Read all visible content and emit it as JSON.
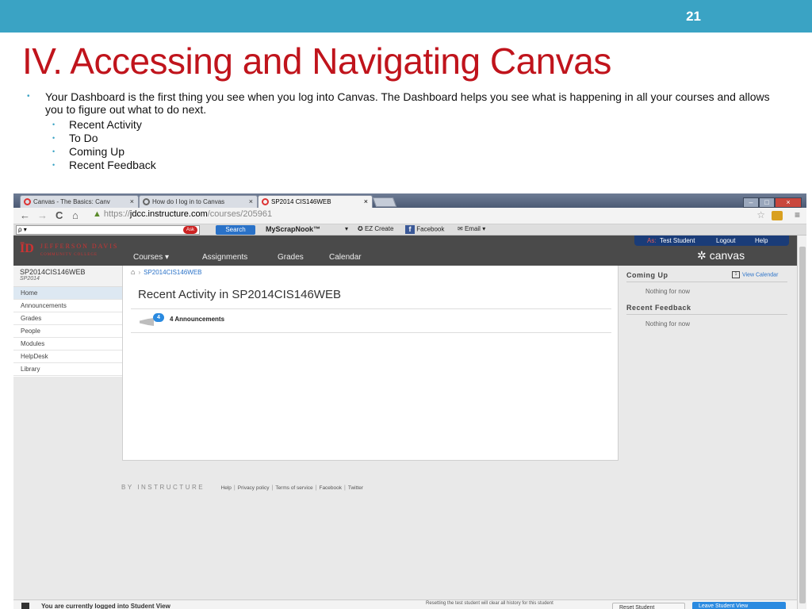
{
  "slide": {
    "number": "21",
    "title": "IV. Accessing and Navigating Canvas",
    "bullet": "Your Dashboard is the first thing you see when you log into Canvas. The Dashboard helps you see what is happening in all your courses and allows you to figure out what to do next.",
    "subbullets": [
      "Recent Activity",
      "To Do",
      "Coming Up",
      "Recent Feedback"
    ]
  },
  "browser": {
    "tabs": [
      "Canvas - The Basics: Canv",
      "How do I log in to Canvas",
      "SP2014 CIS146WEB"
    ],
    "tab_close": "×",
    "window_buttons": [
      "–",
      "□",
      "×"
    ],
    "back": "←",
    "forward": "→",
    "reload": "C",
    "home": "⌂",
    "url_scheme": "https://",
    "url_domain": "jdcc.instructure.com",
    "url_path": "/courses/205961",
    "star": "☆",
    "menu": "≡"
  },
  "toolbar": {
    "search_placeholder": "ρ ▾",
    "search_badge": "Ask",
    "search_button": "Search",
    "myscrapnook": "MyScrapNook™",
    "dropdown": "▾",
    "ez_create": "EZ Create",
    "facebook": "Facebook",
    "email": "Email",
    "email_dropdown": "▾"
  },
  "canvas_header": {
    "logo_mark": "ĪD",
    "logo_line1": "JEFFERSON DAVIS",
    "logo_line2": "COMMUNITY COLLEGE",
    "nav": [
      "Courses ▾",
      "Assignments",
      "Grades",
      "Calendar"
    ],
    "user_prefix": "As:",
    "user": "Test Student",
    "logout": "Logout",
    "help": "Help",
    "brand": "canvas",
    "brand_icon": "✲"
  },
  "sidebar": {
    "course": "SP2014CIS146WEB",
    "term": "SP2014",
    "items": [
      "Home",
      "Announcements",
      "Grades",
      "People",
      "Modules",
      "HelpDesk",
      "Library"
    ]
  },
  "main": {
    "breadcrumb_home": "⌂",
    "breadcrumb_sep": "›",
    "breadcrumb": "SP2014CIS146WEB",
    "title": "Recent Activity in SP2014CIS146WEB",
    "announcement_count": "4",
    "announcement_label": "4 Announcements"
  },
  "right": {
    "coming_up": "Coming Up",
    "view_calendar": "View Calendar",
    "calendar_icon_text": "1",
    "nothing1": "Nothing for now",
    "recent_feedback": "Recent Feedback",
    "nothing2": "Nothing for now"
  },
  "footer": {
    "by": "BY INSTRUCTURE",
    "links": [
      "Help",
      "Privacy policy",
      "Terms of service",
      "Facebook",
      "Twitter"
    ],
    "sep": "|"
  },
  "studentbar": {
    "text": "You are currently logged into Student View",
    "warning": "Resetting the test student will clear all history for this student",
    "reset": "Reset Student",
    "leave": "Leave Student View"
  },
  "colors": {
    "accent": "#3aa3c4",
    "title_red": "#c0141c",
    "link_blue": "#2a72c8",
    "header_dark": "#4a4a4a"
  }
}
